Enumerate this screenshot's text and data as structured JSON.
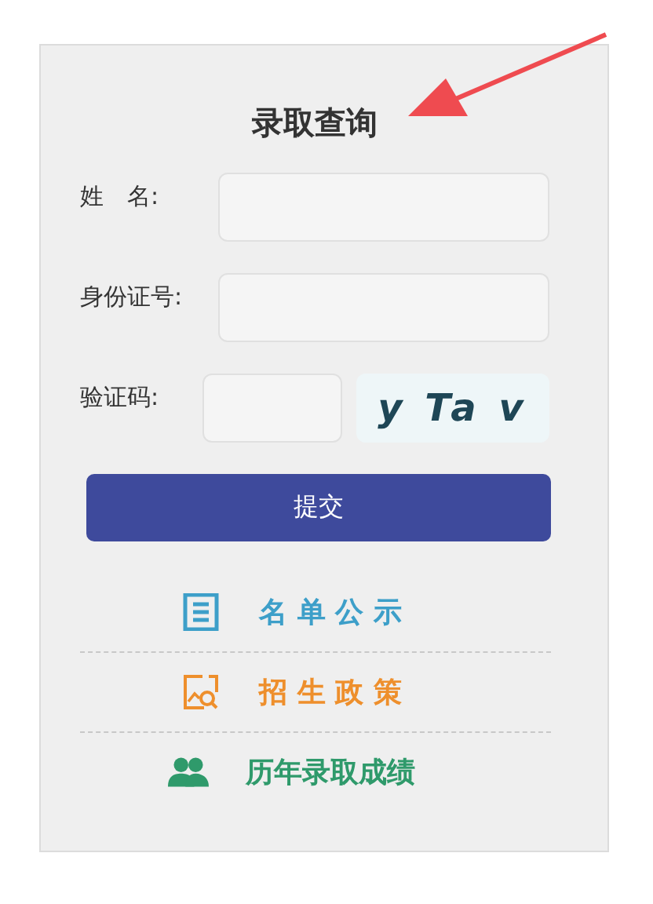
{
  "title": "录取查询",
  "fields": [
    {
      "kind": "text",
      "label": "姓　名:"
    },
    {
      "kind": "text",
      "label": "身份证号:"
    },
    {
      "kind": "captcha",
      "label": "验证码:",
      "captcha": "y Ta v"
    }
  ],
  "submit": "提交",
  "links": [
    {
      "kind": "list",
      "label": "名 单 公 示",
      "color": "#3d9fc9"
    },
    {
      "kind": "policy",
      "label": "招 生 政 策",
      "color": "#ee8f2c"
    },
    {
      "kind": "people",
      "label": "历年录取成绩",
      "color": "#2f9a6b"
    }
  ]
}
